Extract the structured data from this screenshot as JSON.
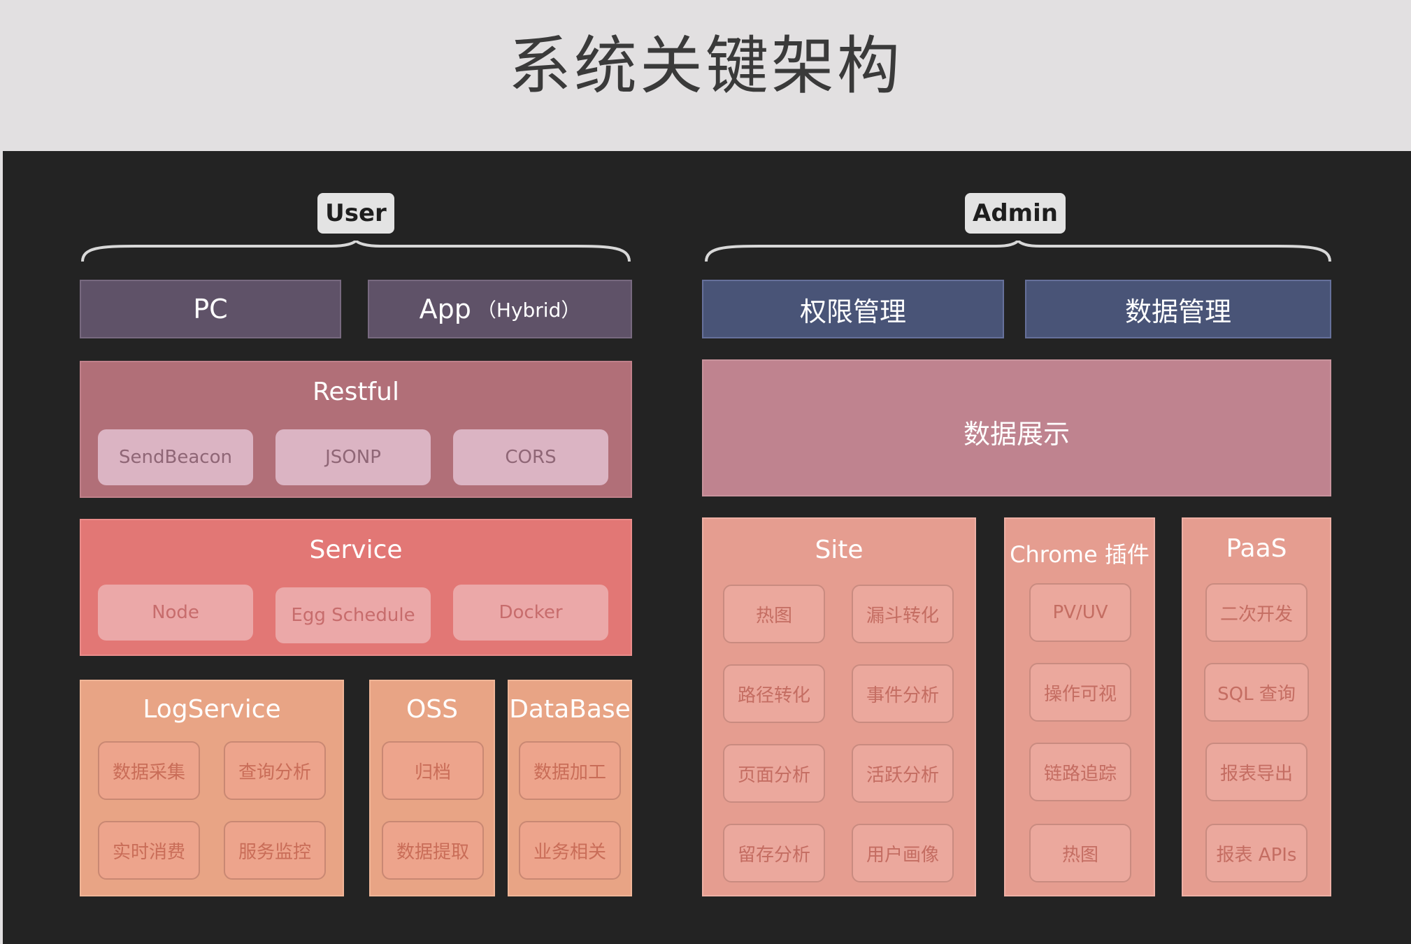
{
  "title": "系统关键架构",
  "user": {
    "label": "User",
    "pc": "PC",
    "app": "App",
    "app_suffix": "（Hybrid）",
    "restful": {
      "title": "Restful",
      "items": [
        "SendBeacon",
        "JSONP",
        "CORS"
      ]
    },
    "service": {
      "title": "Service",
      "items": [
        "Node",
        "Egg Schedule",
        "Docker"
      ]
    },
    "logservice": {
      "title": "LogService",
      "items": [
        "数据采集",
        "查询分析",
        "实时消费",
        "服务监控"
      ]
    },
    "oss": {
      "title": "OSS",
      "items": [
        "归档",
        "数据提取"
      ]
    },
    "database": {
      "title": "DataBase",
      "items": [
        "数据加工",
        "业务相关"
      ]
    }
  },
  "admin": {
    "label": "Admin",
    "perm": "权限管理",
    "data_mgmt": "数据管理",
    "display": "数据展示",
    "site": {
      "title": "Site",
      "items": [
        "热图",
        "漏斗转化",
        "路径转化",
        "事件分析",
        "页面分析",
        "活跃分析",
        "留存分析",
        "用户画像"
      ]
    },
    "chrome": {
      "title": "Chrome 插件",
      "items": [
        "PV/UV",
        "操作可视",
        "链路追踪",
        "热图"
      ]
    },
    "paas": {
      "title": "PaaS",
      "items": [
        "二次开发",
        "SQL 查询",
        "报表导出",
        "报表 APIs"
      ]
    }
  },
  "colors": {
    "restful_bg": "#b16f78",
    "service_bg": "#e27775",
    "orange_bg": "#e8a485",
    "display_bg": "#bf838f",
    "site_bg": "#e59d90"
  }
}
